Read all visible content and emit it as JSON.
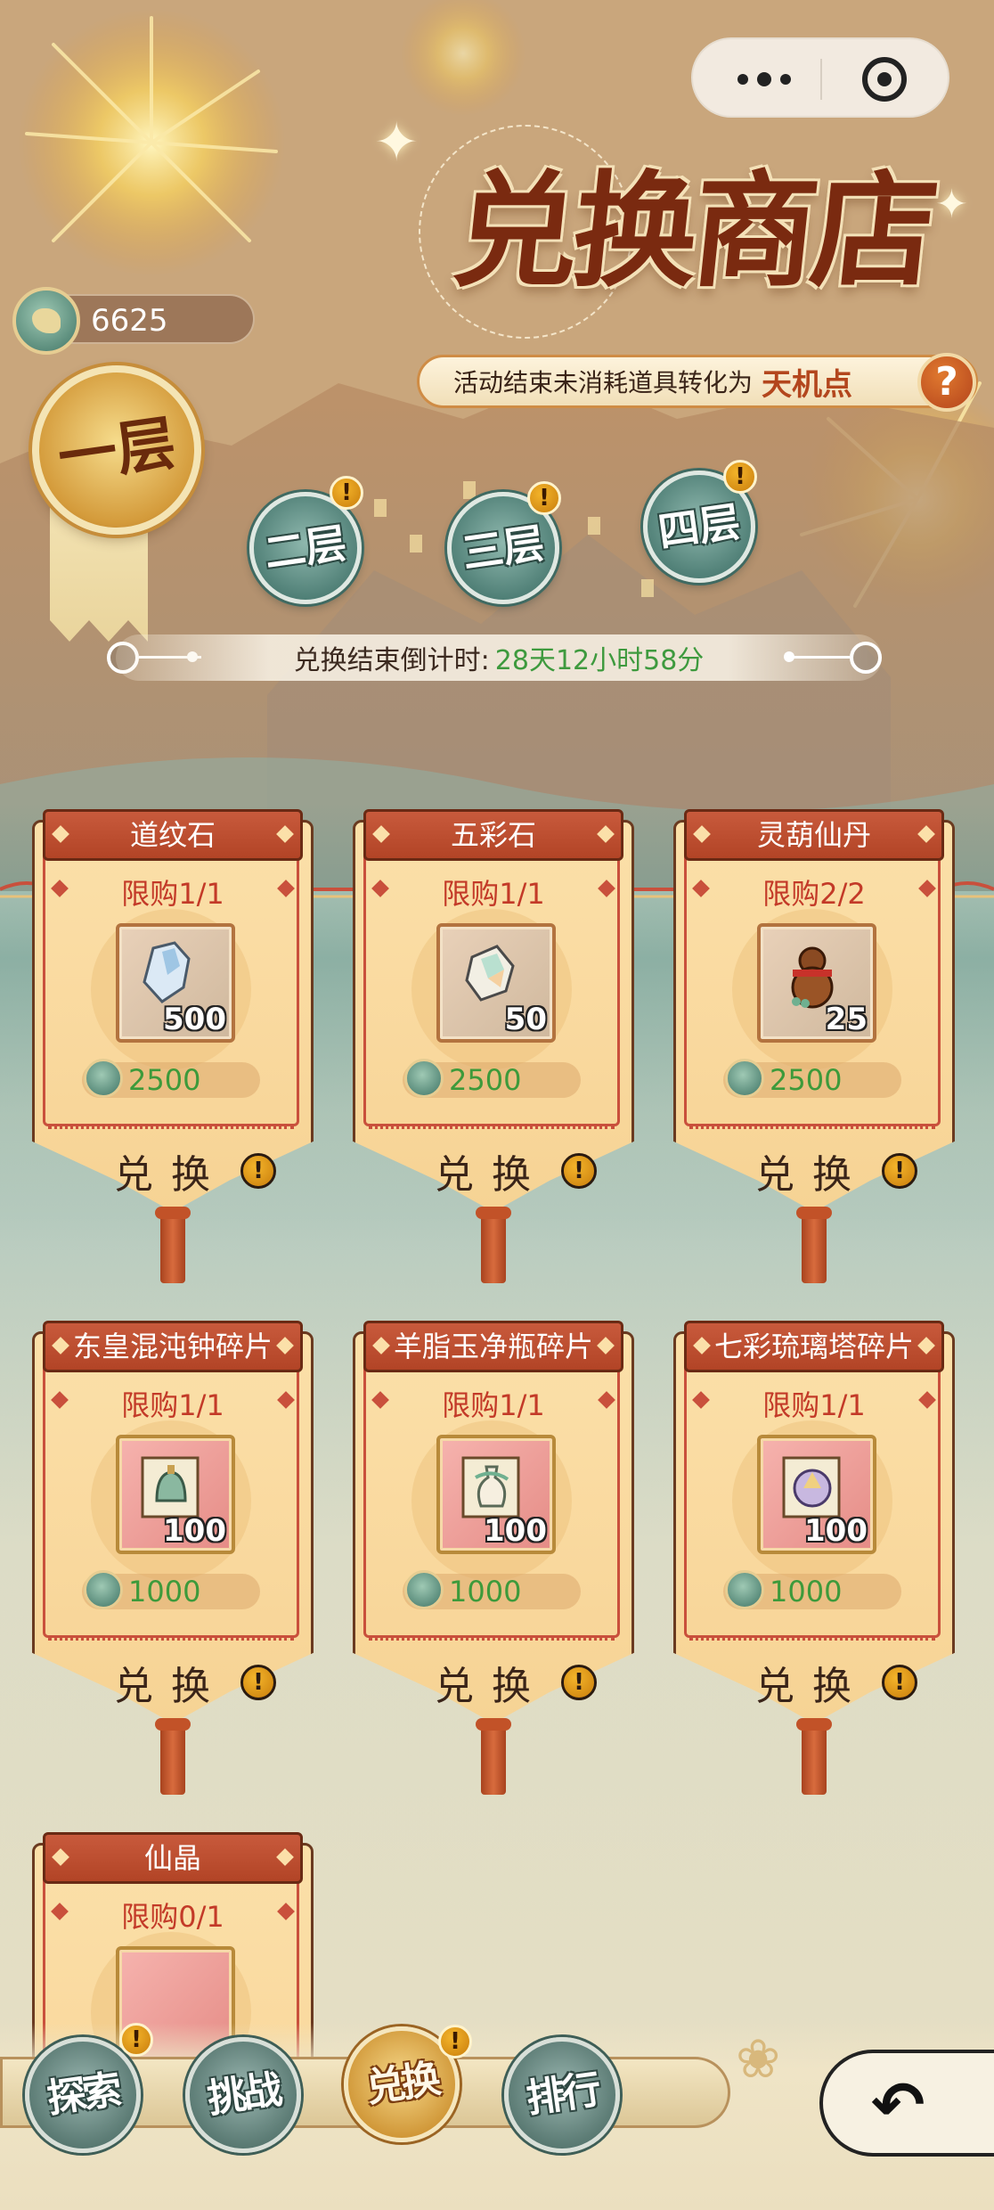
{
  "capsule": {
    "more_icon": "more-dots-icon",
    "close_icon": "target-close-icon"
  },
  "header": {
    "title": "兑换商店",
    "notice_text": "活动结束未消耗道具转化为",
    "notice_highlight": "天机点",
    "help_symbol": "?"
  },
  "currency": {
    "amount": "6625",
    "icon": "jade-coin-icon"
  },
  "layers": [
    {
      "label": "一层",
      "active": true
    },
    {
      "label": "二层",
      "badge": "!"
    },
    {
      "label": "三层",
      "badge": "!"
    },
    {
      "label": "四层",
      "badge": "!"
    }
  ],
  "countdown": {
    "label": "兑换结束倒计时:",
    "time": "28天12小时58分"
  },
  "items": [
    {
      "name": "道纹石",
      "limit": "限购1/1",
      "qty": "500",
      "price": "2500",
      "exchange": "兑换",
      "badge": "!"
    },
    {
      "name": "五彩石",
      "limit": "限购1/1",
      "qty": "50",
      "price": "2500",
      "exchange": "兑换",
      "badge": "!"
    },
    {
      "name": "灵葫仙丹",
      "limit": "限购2/2",
      "qty": "25",
      "price": "2500",
      "exchange": "兑换",
      "badge": "!"
    },
    {
      "name": "东皇混沌钟碎片",
      "limit": "限购1/1",
      "qty": "100",
      "price": "1000",
      "exchange": "兑换",
      "badge": "!"
    },
    {
      "name": "羊脂玉净瓶碎片",
      "limit": "限购1/1",
      "qty": "100",
      "price": "1000",
      "exchange": "兑换",
      "badge": "!"
    },
    {
      "name": "七彩琉璃塔碎片",
      "limit": "限购1/1",
      "qty": "100",
      "price": "1000",
      "exchange": "兑换",
      "badge": "!"
    },
    {
      "name": "仙晶",
      "limit": "限购0/1"
    }
  ],
  "nav": [
    {
      "label": "探索",
      "badge": "!"
    },
    {
      "label": "挑战"
    },
    {
      "label": "兑换",
      "badge": "!",
      "active": true
    },
    {
      "label": "排行"
    }
  ],
  "back": {
    "icon": "back-arrow-icon",
    "symbol": "↶"
  }
}
